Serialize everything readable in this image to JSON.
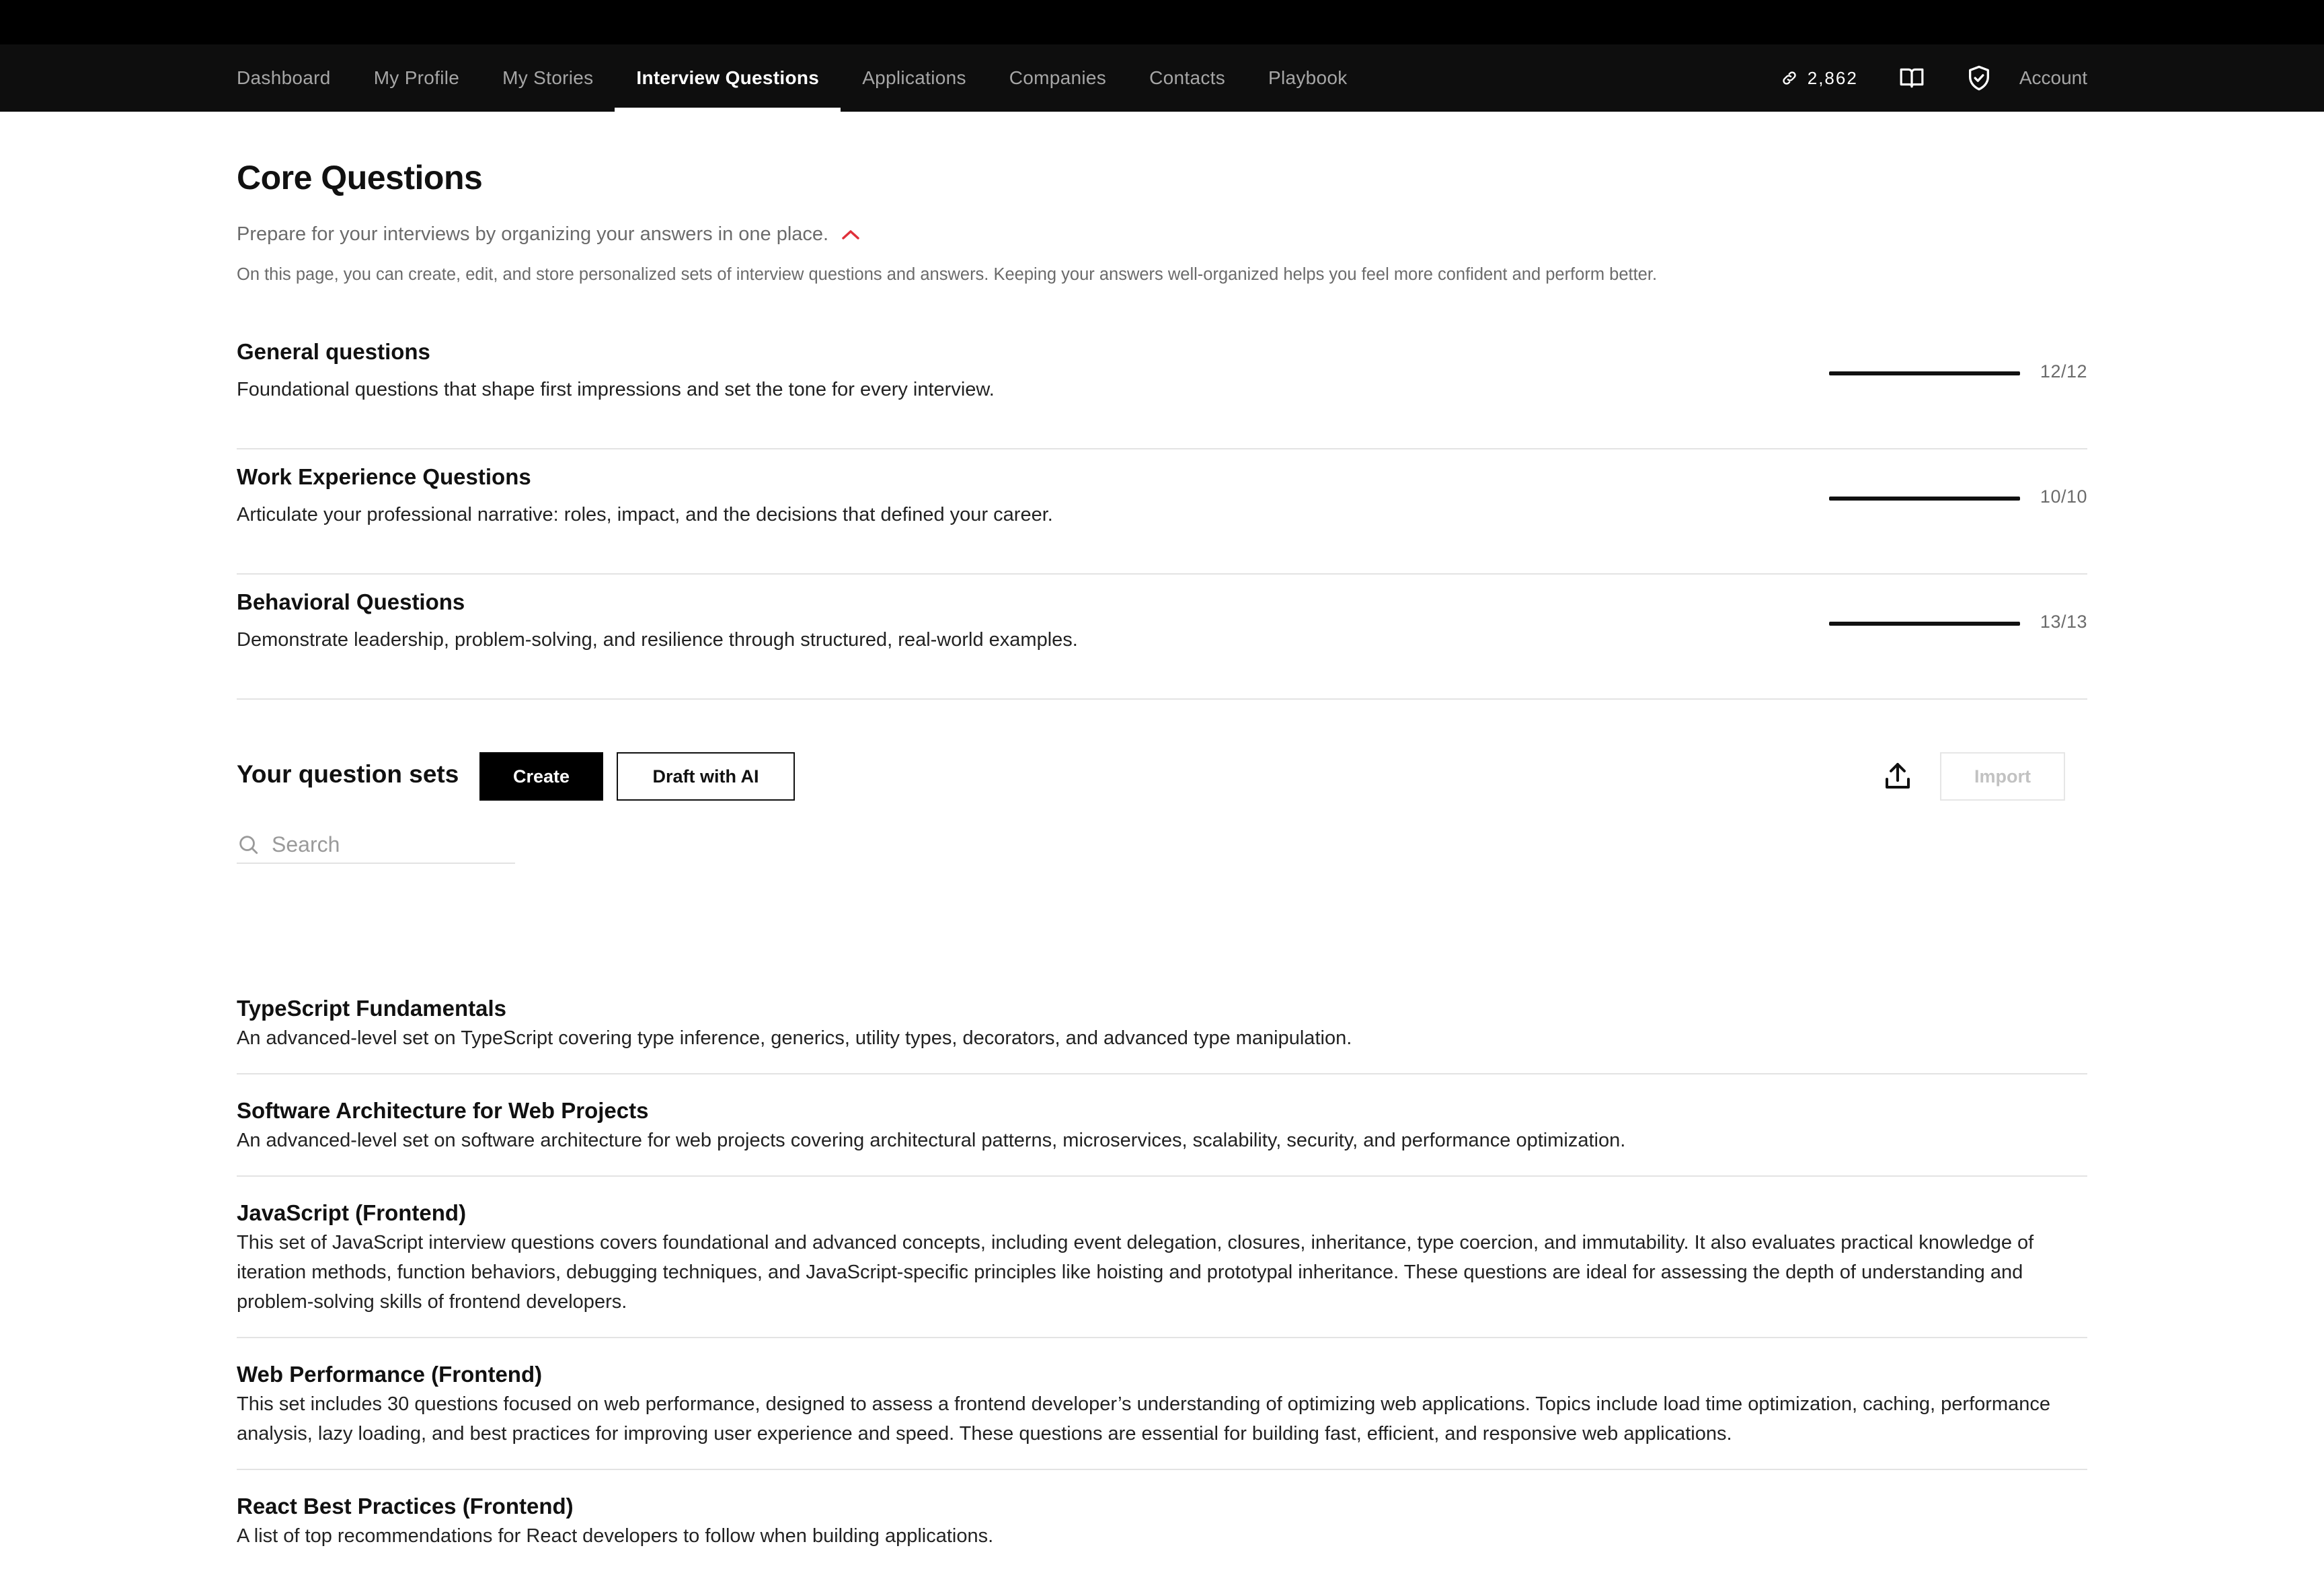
{
  "nav": {
    "items": [
      {
        "label": "Dashboard"
      },
      {
        "label": "My Profile"
      },
      {
        "label": "My Stories"
      },
      {
        "label": "Interview Questions",
        "active": true
      },
      {
        "label": "Applications"
      },
      {
        "label": "Companies"
      },
      {
        "label": "Contacts"
      },
      {
        "label": "Playbook"
      }
    ],
    "credits": "2,862",
    "account_label": "Account",
    "icons": [
      "link-icon",
      "book-icon",
      "shield-check-icon"
    ]
  },
  "page": {
    "title": "Core Questions",
    "subtitle": "Prepare for your interviews by organizing your answers in one place.",
    "intro": "On this page, you can create, edit, and store personalized sets of interview questions and answers. Keeping your answers well-organized helps you feel more confident and perform better."
  },
  "core_questions": [
    {
      "title": "General questions",
      "description": "Foundational questions that shape first impressions and set the tone for every interview.",
      "progress": "12/12",
      "fraction": 1.0
    },
    {
      "title": "Work Experience Questions",
      "description": "Articulate your professional narrative: roles, impact, and the decisions that defined your career.",
      "progress": "10/10",
      "fraction": 1.0
    },
    {
      "title": "Behavioral Questions",
      "description": "Demonstrate leadership, problem-solving, and resilience through structured, real-world examples.",
      "progress": "13/13",
      "fraction": 1.0
    }
  ],
  "question_sets": {
    "title": "Your question sets",
    "create_label": "Create",
    "draft_label": "Draft with AI",
    "import_label": "Import",
    "search_placeholder": "Search",
    "items": [
      {
        "title": "TypeScript Fundamentals",
        "description": "An advanced-level set on TypeScript covering type inference, generics, utility types, decorators, and advanced type manipulation."
      },
      {
        "title": "Software Architecture for Web Projects",
        "description": "An advanced-level set on software architecture for web projects covering architectural patterns, microservices, scalability, security, and performance optimization."
      },
      {
        "title": "JavaScript (Frontend)",
        "description": "This set of JavaScript interview questions covers foundational and advanced concepts, including event delegation, closures, inheritance, type coercion, and immutability. It also evaluates practical knowledge of iteration methods, function behaviors, debugging techniques, and JavaScript-specific principles like hoisting and prototypal inheritance. These questions are ideal for assessing the depth of understanding and problem-solving skills of frontend developers."
      },
      {
        "title": "Web Performance (Frontend)",
        "description": "This set includes 30 questions focused on web performance, designed to assess a frontend developer’s understanding of optimizing web applications. Topics include load time optimization, caching, performance analysis, lazy loading, and best practices for improving user experience and speed. These questions are essential for building fast, efficient, and responsive web applications."
      },
      {
        "title": "React Best Practices (Frontend)",
        "description": "A list of top recommendations for React developers to follow when building applications."
      }
    ]
  },
  "colors": {
    "nav_bg": "#0e0e0e",
    "accent_red": "#e0303a",
    "text": "#111111",
    "muted": "#6b6b6b"
  }
}
